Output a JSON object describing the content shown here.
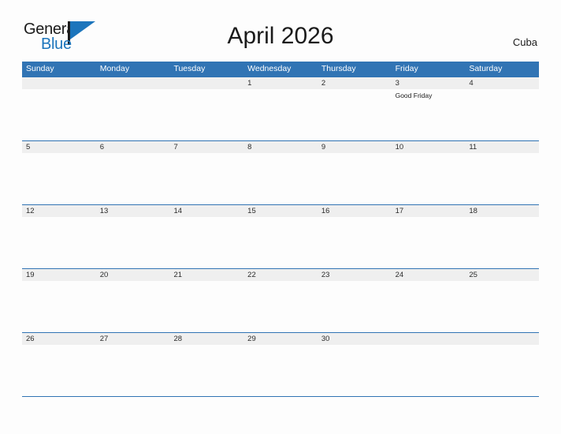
{
  "brand": {
    "name_part1": "General",
    "name_part2": "Blue",
    "triangle_icon": "triangle-icon",
    "accent_color": "#1c75bc"
  },
  "header": {
    "title": "April 2026",
    "location": "Cuba"
  },
  "theme": {
    "header_blue": "#3174b4",
    "band_gray": "#efefef",
    "page_background": "#fdfdfd",
    "text_color": "#1b1b1b"
  },
  "calendar": {
    "weekday_headers": [
      "Sunday",
      "Monday",
      "Tuesday",
      "Wednesday",
      "Thursday",
      "Friday",
      "Saturday"
    ],
    "weeks": [
      {
        "days": [
          {
            "date": "",
            "event": ""
          },
          {
            "date": "",
            "event": ""
          },
          {
            "date": "",
            "event": ""
          },
          {
            "date": "1",
            "event": ""
          },
          {
            "date": "2",
            "event": ""
          },
          {
            "date": "3",
            "event": "Good Friday"
          },
          {
            "date": "4",
            "event": ""
          }
        ]
      },
      {
        "days": [
          {
            "date": "5",
            "event": ""
          },
          {
            "date": "6",
            "event": ""
          },
          {
            "date": "7",
            "event": ""
          },
          {
            "date": "8",
            "event": ""
          },
          {
            "date": "9",
            "event": ""
          },
          {
            "date": "10",
            "event": ""
          },
          {
            "date": "11",
            "event": ""
          }
        ]
      },
      {
        "days": [
          {
            "date": "12",
            "event": ""
          },
          {
            "date": "13",
            "event": ""
          },
          {
            "date": "14",
            "event": ""
          },
          {
            "date": "15",
            "event": ""
          },
          {
            "date": "16",
            "event": ""
          },
          {
            "date": "17",
            "event": ""
          },
          {
            "date": "18",
            "event": ""
          }
        ]
      },
      {
        "days": [
          {
            "date": "19",
            "event": ""
          },
          {
            "date": "20",
            "event": ""
          },
          {
            "date": "21",
            "event": ""
          },
          {
            "date": "22",
            "event": ""
          },
          {
            "date": "23",
            "event": ""
          },
          {
            "date": "24",
            "event": ""
          },
          {
            "date": "25",
            "event": ""
          }
        ]
      },
      {
        "days": [
          {
            "date": "26",
            "event": ""
          },
          {
            "date": "27",
            "event": ""
          },
          {
            "date": "28",
            "event": ""
          },
          {
            "date": "29",
            "event": ""
          },
          {
            "date": "30",
            "event": ""
          },
          {
            "date": "",
            "event": ""
          },
          {
            "date": "",
            "event": ""
          }
        ]
      }
    ]
  }
}
